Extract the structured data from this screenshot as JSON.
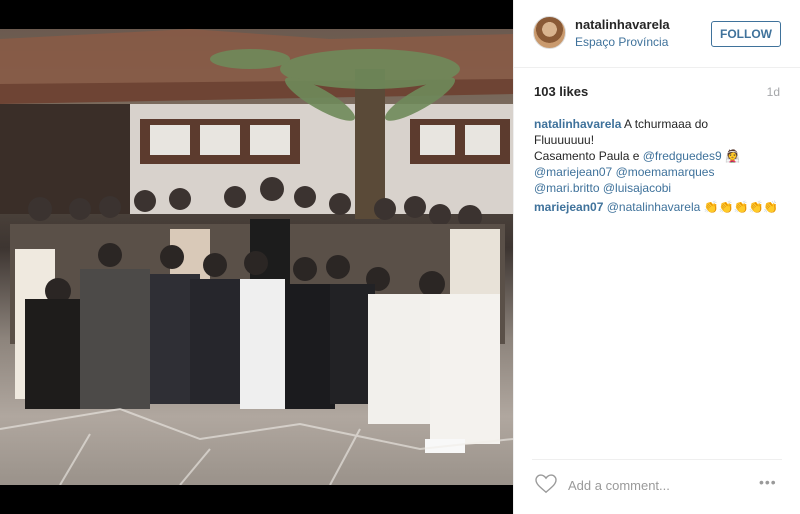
{
  "post": {
    "username": "natalinhavarela",
    "location": "Espaço Província",
    "follow_label": "FOLLOW",
    "likes": "103 likes",
    "time_ago": "1d",
    "caption": {
      "user": "natalinhavarela",
      "line1": "A tchurmaaa do",
      "line2": "Fluuuuuuu! ",
      "line3_text": "Casamento Paula e",
      "mentions_line3": "@fredguedes9",
      "mentions_line4a": "@mariejean07",
      "mentions_line4b": "@moemamarques",
      "mentions_line5a": "@mari.britto",
      "mentions_line5b": "@luisajacobi"
    },
    "comments": [
      {
        "user": "mariejean07",
        "mention": "@natalinhavarela",
        "emoji": "👏👏👏👏👏"
      }
    ],
    "add_comment_placeholder": "Add a comment...",
    "more_label": "•••"
  },
  "colors": {
    "link": "#3f729b",
    "text": "#262626",
    "muted": "#a5a7aa",
    "divider": "#efefef"
  },
  "icons": {
    "like": "heart-icon",
    "more": "more-options-icon"
  }
}
